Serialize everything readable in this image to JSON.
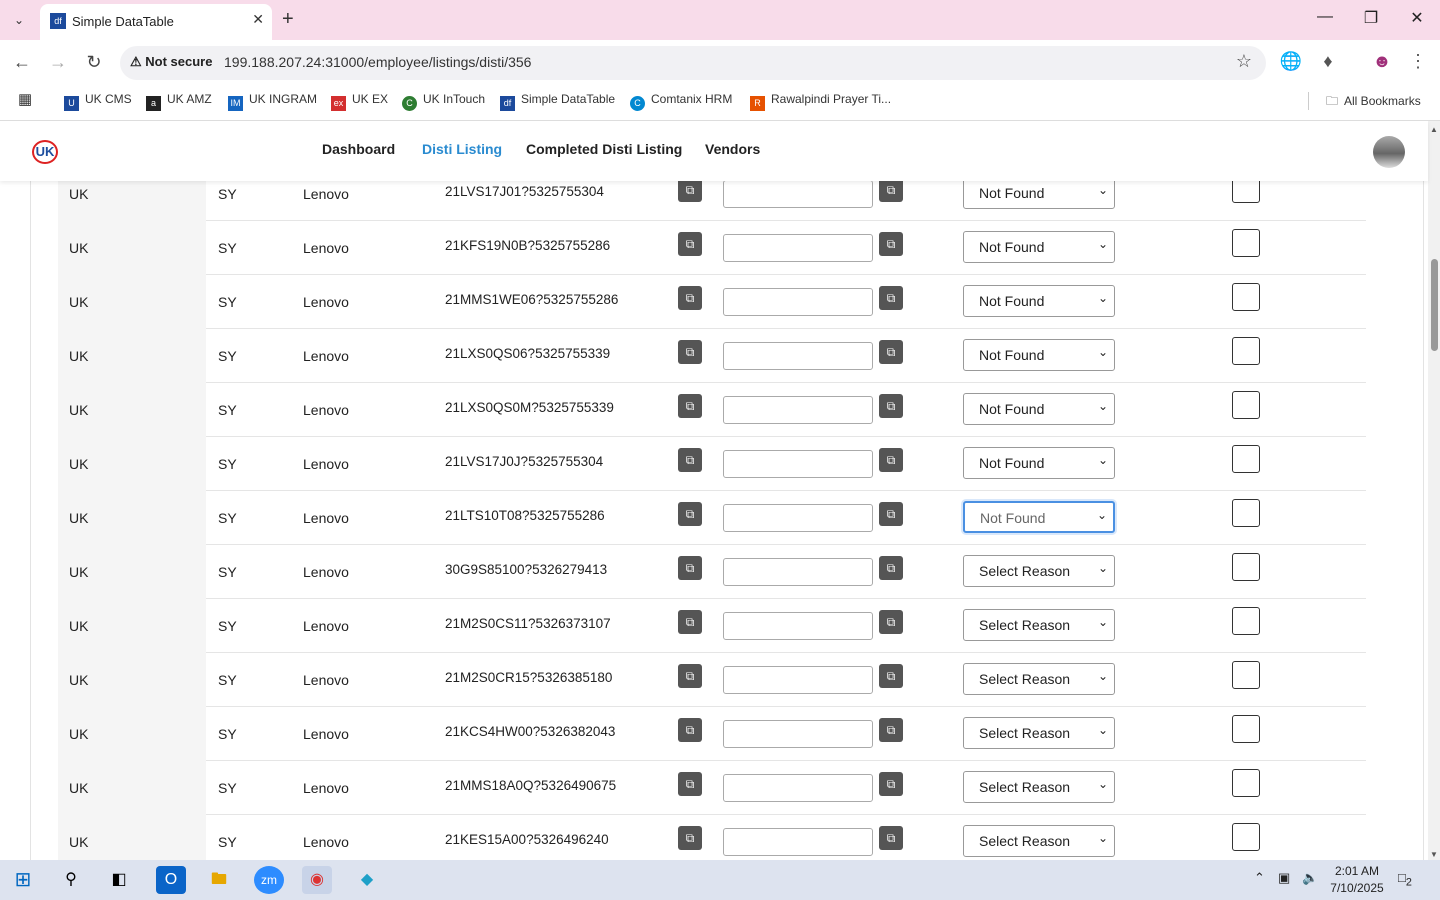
{
  "browser": {
    "tab_title": "Simple DataTable",
    "tab_favicon": "df",
    "security_label": "Not secure",
    "url": "199.188.207.24:31000/employee/listings/disti/356",
    "bookmarks": [
      {
        "label": "UK CMS",
        "icon": "uk-cms-icon",
        "color": "#1c4a9c"
      },
      {
        "label": "UK AMZ",
        "icon": "amazon-icon",
        "color": "#222222"
      },
      {
        "label": "UK INGRAM",
        "icon": "ingram-icon",
        "color": "#1565c0"
      },
      {
        "label": "UK EX",
        "icon": "ex-icon",
        "color": "#d32f2f"
      },
      {
        "label": "UK InTouch",
        "icon": "intouch-icon",
        "color": "#2e7d32"
      },
      {
        "label": "Simple DataTable",
        "icon": "datatable-icon",
        "color": "#1c4a9c"
      },
      {
        "label": "Comtanix HRM",
        "icon": "hrm-icon",
        "color": "#0288d1"
      },
      {
        "label": "Rawalpindi Prayer Ti...",
        "icon": "prayer-icon",
        "color": "#e65100"
      }
    ],
    "all_bookmarks": "All Bookmarks"
  },
  "nav": {
    "logo_text": "UK",
    "links": [
      "Dashboard",
      "Disti Listing",
      "Completed Disti Listing",
      "Vendors"
    ],
    "active": "Disti Listing"
  },
  "rows": [
    {
      "c1": "UK",
      "c2": "SY",
      "c3": "Lenovo",
      "sku": "21LVS17J01?5325755304",
      "reason": "Not Found"
    },
    {
      "c1": "UK",
      "c2": "SY",
      "c3": "Lenovo",
      "sku": "21KFS19N0B?5325755286",
      "reason": "Not Found"
    },
    {
      "c1": "UK",
      "c2": "SY",
      "c3": "Lenovo",
      "sku": "21MMS1WE06?5325755286",
      "reason": "Not Found"
    },
    {
      "c1": "UK",
      "c2": "SY",
      "c3": "Lenovo",
      "sku": "21LXS0QS06?5325755339",
      "reason": "Not Found"
    },
    {
      "c1": "UK",
      "c2": "SY",
      "c3": "Lenovo",
      "sku": "21LXS0QS0M?5325755339",
      "reason": "Not Found"
    },
    {
      "c1": "UK",
      "c2": "SY",
      "c3": "Lenovo",
      "sku": "21LVS17J0J?5325755304",
      "reason": "Not Found"
    },
    {
      "c1": "UK",
      "c2": "SY",
      "c3": "Lenovo",
      "sku": "21LTS10T08?5325755286",
      "reason": "Not Found",
      "focused": true
    },
    {
      "c1": "UK",
      "c2": "SY",
      "c3": "Lenovo",
      "sku": "30G9S85100?5326279413",
      "reason": "Select Reason"
    },
    {
      "c1": "UK",
      "c2": "SY",
      "c3": "Lenovo",
      "sku": "21M2S0CS11?5326373107",
      "reason": "Select Reason"
    },
    {
      "c1": "UK",
      "c2": "SY",
      "c3": "Lenovo",
      "sku": "21M2S0CR15?5326385180",
      "reason": "Select Reason"
    },
    {
      "c1": "UK",
      "c2": "SY",
      "c3": "Lenovo",
      "sku": "21KCS4HW00?5326382043",
      "reason": "Select Reason"
    },
    {
      "c1": "UK",
      "c2": "SY",
      "c3": "Lenovo",
      "sku": "21MMS18A0Q?5326490675",
      "reason": "Select Reason"
    },
    {
      "c1": "UK",
      "c2": "SY",
      "c3": "Lenovo",
      "sku": "21KES15A00?5326496240",
      "reason": "Select Reason"
    }
  ],
  "taskbar": {
    "time": "2:01 AM",
    "date": "7/10/2025",
    "notification_count": "2"
  }
}
